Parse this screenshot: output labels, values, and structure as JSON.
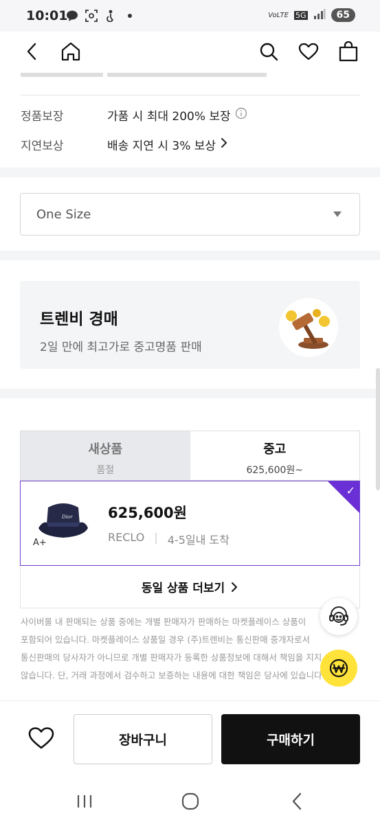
{
  "status": {
    "time": "10:01",
    "battery": "65",
    "network": "5G"
  },
  "nav": {
    "back_icon": "chevron-left-icon",
    "home_icon": "home-icon",
    "search_icon": "search-icon",
    "wishlist_icon": "heart-icon",
    "bag_icon": "shopping-bag-icon"
  },
  "info": {
    "rows": [
      {
        "label": "정품보장",
        "value": "가품 시 최대 200% 보장"
      },
      {
        "label": "지연보상",
        "value": "배송 지연 시 3% 보상"
      }
    ]
  },
  "option": {
    "selected": "One Size"
  },
  "auction": {
    "title": "트렌비 경매",
    "subtitle": "2일 만에 최고가로 중고명품 판매"
  },
  "tabs": [
    {
      "label": "새상품",
      "sub": "품절"
    },
    {
      "label": "중고",
      "sub": "625,600원~"
    }
  ],
  "product": {
    "grade": "A+",
    "price": "625,600원",
    "seller": "RECLO",
    "delivery": "4-5일내 도착"
  },
  "more": {
    "label": "동일 상품 더보기"
  },
  "disclaimer": [
    "사이버몰 내 판매되는 상품 중에는 개별 판매자가 판매하는 마켓플레이스 상품이",
    "포함되어 있습니다. 마켓플레이스 상품일 경우 (주)트렌비는 통신판매 중개자로서",
    "통신판매의 당사자가 아니므로 개별 판매자가 등록한 상품정보에 대해서 책임을 지지",
    "않습니다. 단, 거래 과정에서 검수하고 보증하는 내용에 대한 책임은 당사에 있습니다."
  ],
  "bottom": {
    "cart": "장바구니",
    "buy": "구매하기"
  },
  "colors": {
    "accent": "#6b2fd6",
    "fab_yellow": "#ffe33a",
    "buy_bg": "#111111"
  }
}
